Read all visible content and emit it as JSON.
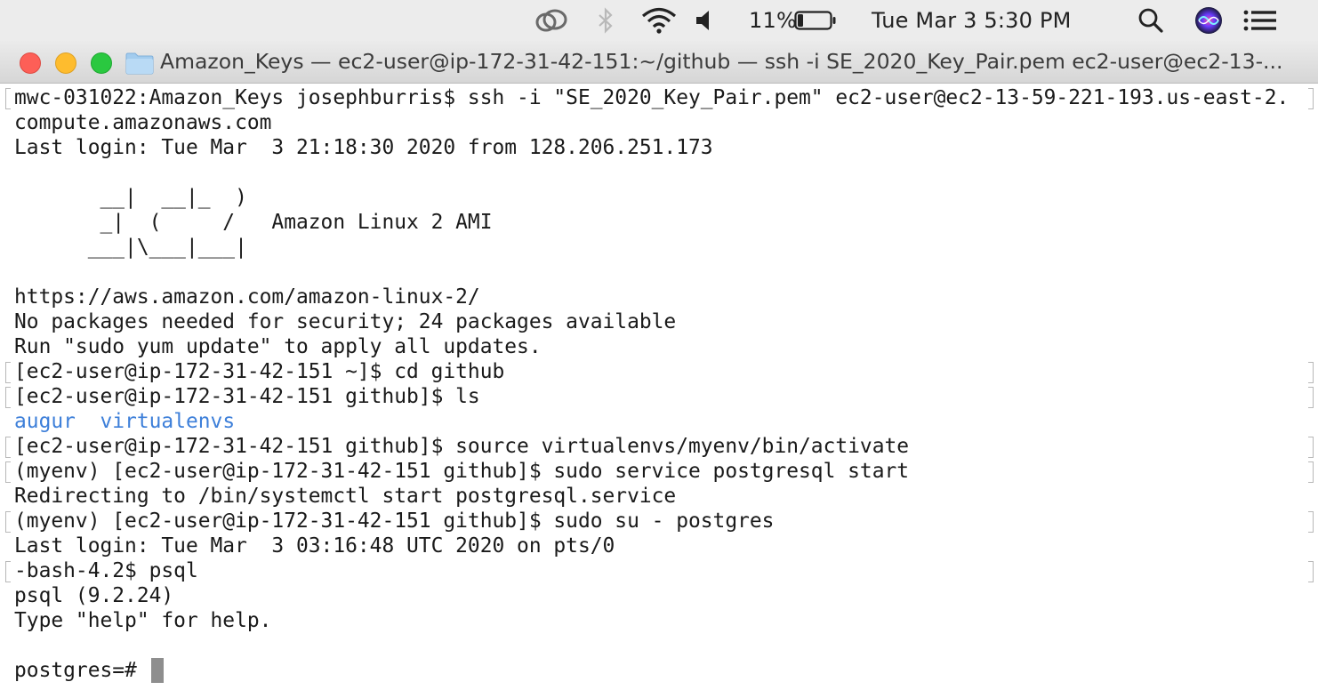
{
  "menubar": {
    "battery_percent": "11%",
    "clock": "Tue Mar 3  5:30 PM",
    "battery_level": 0.11,
    "icons": [
      "creative-cloud-icon",
      "bluetooth-icon",
      "wifi-icon",
      "volume-icon",
      "battery-icon",
      "spotlight-search-icon",
      "siri-icon",
      "notification-center-icon"
    ]
  },
  "window": {
    "title": "Amazon_Keys — ec2-user@ip-172-31-42-151:~/github — ssh -i SE_2020_Key_Pair.pem ec2-user@ec2-13-..."
  },
  "terminal": {
    "lines": [
      "mwc-031022:Amazon_Keys josephburris$ ssh -i \"SE_2020_Key_Pair.pem\" ec2-user@ec2-13-59-221-193.us-east-2.",
      "compute.amazonaws.com",
      "Last login: Tue Mar  3 21:18:30 2020 from 128.206.251.173",
      "",
      "       __|  __|_  )",
      "       _|  (     /   Amazon Linux 2 AMI",
      "      ___|\\___|___|",
      "",
      "https://aws.amazon.com/amazon-linux-2/",
      "No packages needed for security; 24 packages available",
      "Run \"sudo yum update\" to apply all updates.",
      "[ec2-user@ip-172-31-42-151 ~]$ cd github",
      "[ec2-user@ip-172-31-42-151 github]$ ls",
      "",
      "[ec2-user@ip-172-31-42-151 github]$ source virtualenvs/myenv/bin/activate",
      "(myenv) [ec2-user@ip-172-31-42-151 github]$ sudo service postgresql start",
      "Redirecting to /bin/systemctl start postgresql.service",
      "(myenv) [ec2-user@ip-172-31-42-151 github]$ sudo su - postgres",
      "Last login: Tue Mar  3 03:16:48 UTC 2020 on pts/0",
      "-bash-4.2$ psql",
      "psql (9.2.24)",
      "Type \"help\" for help.",
      "",
      "postgres=# "
    ],
    "ls_output": {
      "dir1": "augur",
      "dir2": "virtualenvs"
    },
    "colors": {
      "directory": "#3d7fd9",
      "text": "#1a1a1a",
      "cursor": "#8e8e8e"
    }
  }
}
